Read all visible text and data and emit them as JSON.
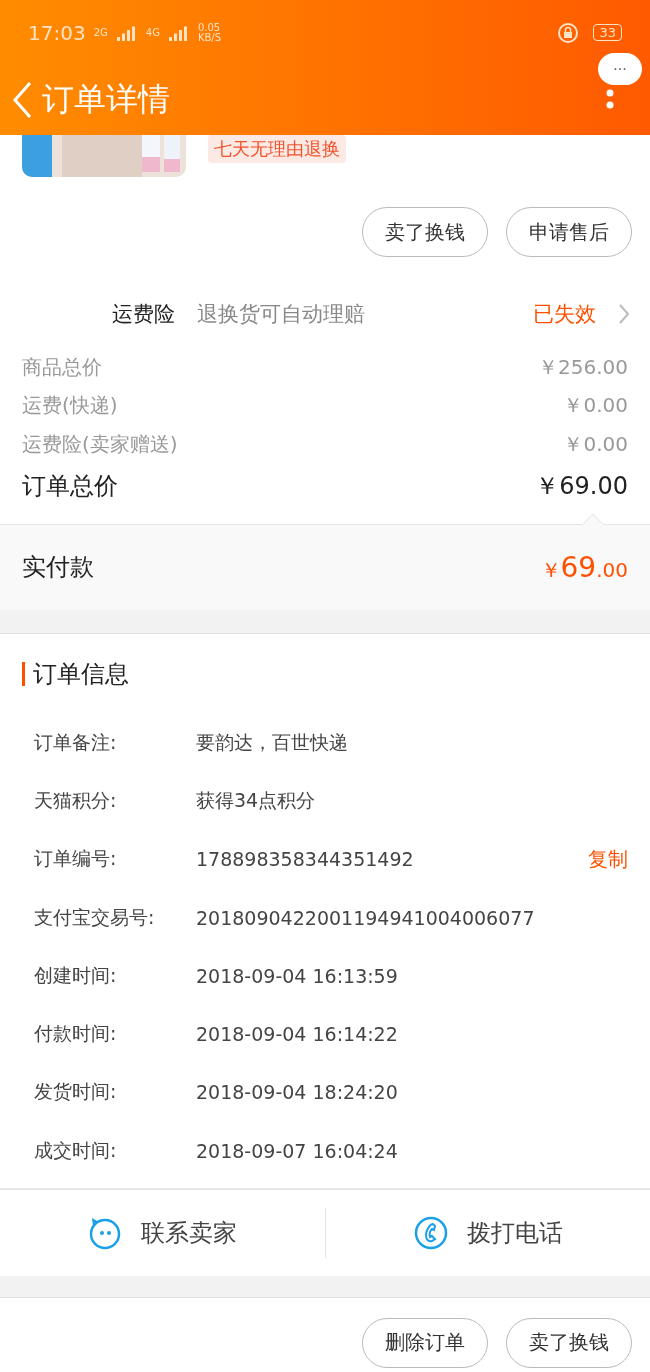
{
  "status_bar": {
    "time": "17:03",
    "net_2g": "2G",
    "net_4g": "4G",
    "speed": "0.05",
    "speed_unit": "KB/S",
    "battery": "33"
  },
  "nav": {
    "title": "订单详情",
    "more": "···"
  },
  "product": {
    "tag": "七天无理由退换"
  },
  "actions_top": [
    "卖了换钱",
    "申请售后"
  ],
  "insurance": {
    "label": "运费险",
    "desc": "退换货可自动理赔",
    "status": "已失效"
  },
  "prices": [
    {
      "label": "商品总价",
      "value": "￥256.00",
      "kind": "minor"
    },
    {
      "label": "运费(快递)",
      "value": "￥0.00",
      "kind": "minor"
    },
    {
      "label": "运费险(卖家赠送)",
      "value": "￥0.00",
      "kind": "minor"
    },
    {
      "label": "订单总价",
      "value": "￥69.00",
      "kind": "total"
    }
  ],
  "paid": {
    "label": "实付款",
    "currency": "￥",
    "int": "69",
    "dec": ".00"
  },
  "order_info": {
    "title": "订单信息",
    "rows": [
      {
        "label": "订单备注:",
        "value": "要韵达，百世快递"
      },
      {
        "label": "天猫积分:",
        "value": "获得34点积分"
      },
      {
        "label": "订单编号:",
        "value": "178898358344351492",
        "action": "复制"
      },
      {
        "label": "支付宝交易号:",
        "value": "2018090422001194941004006077"
      },
      {
        "label": "创建时间:",
        "value": "2018-09-04 16:13:59"
      },
      {
        "label": "付款时间:",
        "value": "2018-09-04 16:14:22"
      },
      {
        "label": "发货时间:",
        "value": "2018-09-04 18:24:20"
      },
      {
        "label": "成交时间:",
        "value": "2018-09-07 16:04:24"
      }
    ]
  },
  "contact": [
    {
      "label": "联系卖家",
      "kind": "chat"
    },
    {
      "label": "拨打电话",
      "kind": "phone"
    }
  ],
  "actions_bottom": [
    "删除订单",
    "卖了换钱"
  ]
}
